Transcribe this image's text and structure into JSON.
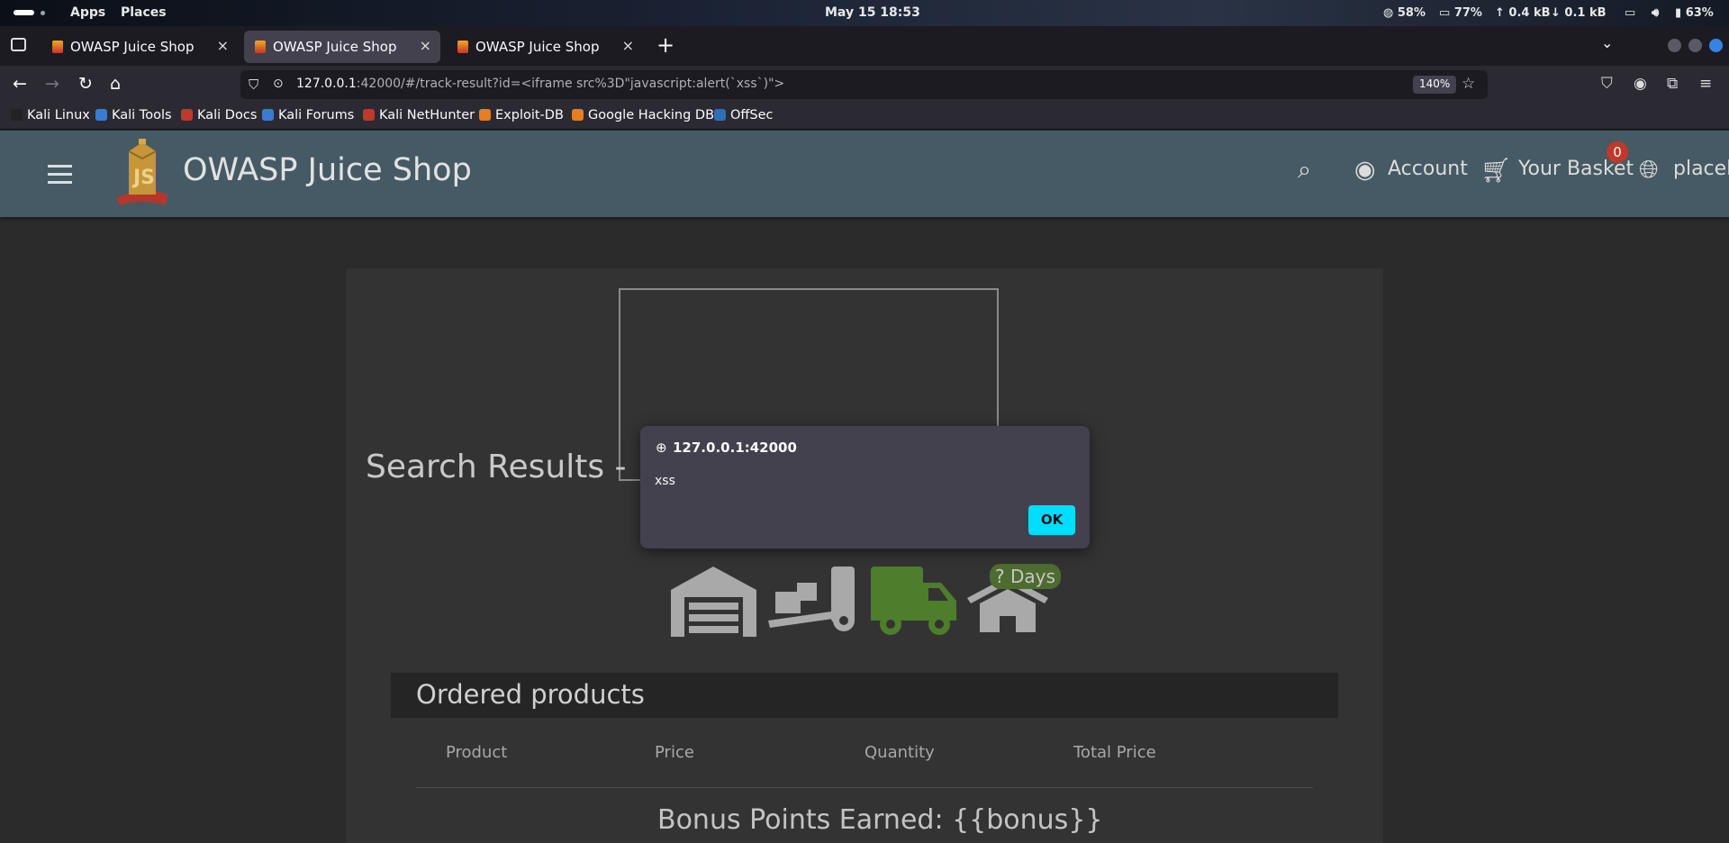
{
  "os": {
    "apps": "Apps",
    "places": "Places",
    "clock": "May 15  18:53",
    "stats": [
      "58%",
      "77%",
      "0.4 kB",
      "0.1 kB",
      "63%"
    ]
  },
  "tabs": [
    {
      "title": "OWASP Juice Shop"
    },
    {
      "title": "OWASP Juice Shop"
    },
    {
      "title": "OWASP Juice Shop"
    }
  ],
  "nav": {
    "url_host": "127.0.0.1",
    "url_rest": ":42000/#/track-result?id=<iframe src%3D\"javascript:alert(`xss`)\">",
    "zoom": "140%"
  },
  "bookmarks": [
    "Kali Linux",
    "Kali Tools",
    "Kali Docs",
    "Kali Forums",
    "Kali NetHunter",
    "Exploit-DB",
    "Google Hacking DB",
    "OffSec"
  ],
  "app": {
    "name": "OWASP Juice Shop",
    "account": "Account",
    "basket": "Your Basket",
    "basket_count": "0",
    "language": "placeh"
  },
  "main": {
    "search_title": "Search Results -",
    "days_badge": "? Days",
    "ordered_title": "Ordered products",
    "columns": [
      "Product",
      "Price",
      "Quantity",
      "Total Price"
    ],
    "bonus": "Bonus Points Earned: {{bonus}}"
  },
  "dialog": {
    "origin": "127.0.0.1:42000",
    "message": "xss",
    "ok": "OK"
  },
  "colors": {
    "toolbar": "#455a64",
    "accent": "#00ddff",
    "truck": "#4e7d2b",
    "badge": "#c0392b"
  }
}
